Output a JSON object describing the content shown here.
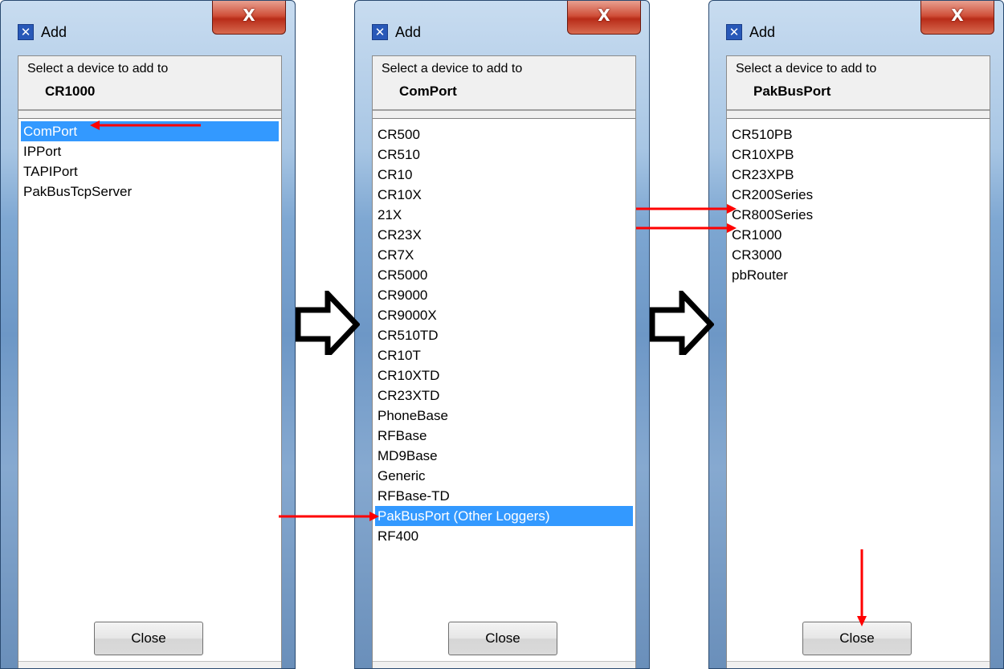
{
  "dialogs": [
    {
      "title": "Add",
      "close_glyph": "X",
      "prompt": "Select a device to add to",
      "target": "CR1000",
      "items": [
        "ComPort",
        "IPPort",
        "TAPIPort",
        "PakBusTcpServer"
      ],
      "selected_index": 0,
      "close_label": "Close"
    },
    {
      "title": "Add",
      "close_glyph": "X",
      "prompt": "Select a device to add to",
      "target": "ComPort",
      "items": [
        "CR500",
        "CR510",
        "CR10",
        "CR10X",
        "21X",
        "CR23X",
        "CR7X",
        "CR5000",
        "CR9000",
        "CR9000X",
        "CR510TD",
        "CR10T",
        "CR10XTD",
        "CR23XTD",
        "PhoneBase",
        "RFBase",
        "MD9Base",
        "Generic",
        "RFBase-TD",
        "PakBusPort (Other Loggers)",
        "RF400"
      ],
      "selected_index": 19,
      "close_label": "Close"
    },
    {
      "title": "Add",
      "close_glyph": "X",
      "prompt": "Select a device to add to",
      "target": "PakBusPort",
      "items": [
        "CR510PB",
        "CR10XPB",
        "CR23XPB",
        "CR200Series",
        "CR800Series",
        "CR1000",
        "CR3000",
        "pbRouter"
      ],
      "selected_index": -1,
      "close_label": "Close"
    }
  ],
  "icons": {
    "app_icon": "campbell-app-icon",
    "flow_arrow": "right-arrow-outline-icon",
    "annotation": "red-arrow-icon"
  },
  "colors": {
    "selection": "#3399ff",
    "annotation": "#ff0000",
    "close_button_red": "#c8402a"
  }
}
